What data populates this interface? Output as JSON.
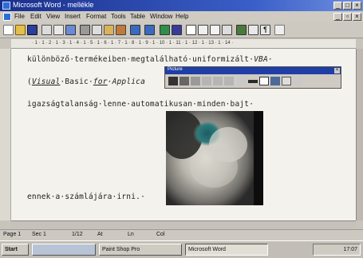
{
  "window": {
    "title": "Microsoft Word - mellékle"
  },
  "menu": [
    "File",
    "Edit",
    "View",
    "Insert",
    "Format",
    "Tools",
    "Table",
    "Window",
    "Help"
  ],
  "document": {
    "line1_a": "különböző·termékeiben·megtalálható·uniformizált·",
    "line1_b": "VBA",
    "line1_c": "·",
    "line2_a": "(",
    "line2_b": "Visual",
    "line2_c": "·Basic·",
    "line2_d": "for",
    "line2_e": "·Applica",
    "line3": "igazságtalanság·lenne·automatikusan·minden·bajt·",
    "line4": "ennek·a·számlájára·irni.·"
  },
  "picture_toolbar": {
    "title": "Picture"
  },
  "status": {
    "page": "Page 1",
    "sec": "Sec 1",
    "pos": "1/12",
    "at": "At",
    "ln": "Ln",
    "col": "Col"
  },
  "taskbar": {
    "start": "Start",
    "paintshop": "Paint Shop Pro",
    "word": "Microsoft Word",
    "clock": "17:07"
  },
  "colors": {
    "titlebar": "#1a2f8c",
    "picture_toolbar_caption": "#1f3ea6"
  }
}
